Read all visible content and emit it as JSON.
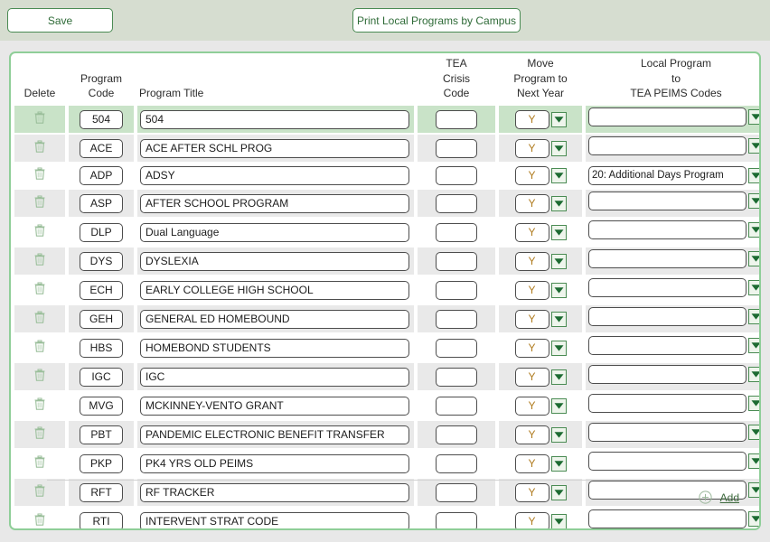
{
  "toolbar": {
    "save_label": "Save",
    "print_label": "Print Local Programs by Campus"
  },
  "table": {
    "headers": {
      "delete": "Delete",
      "program_code": "Program\nCode",
      "program_code_line1": "Program",
      "program_code_line2": "Code",
      "program_title": "Program Title",
      "tea_crisis_code_line1": "TEA",
      "tea_crisis_code_line2": "Crisis",
      "tea_crisis_code_line3": "Code",
      "move_program_line1": "Move",
      "move_program_line2": "Program to",
      "move_program_line3": "Next Year",
      "local_program_line1": "Local Program",
      "local_program_line2": "to",
      "local_program_line3": "TEA PEIMS Codes"
    },
    "rows": [
      {
        "code": "504",
        "title": "504",
        "crisis": "",
        "move": "Y",
        "peims": "",
        "selected": true
      },
      {
        "code": "ACE",
        "title": "ACE AFTER SCHL PROG",
        "crisis": "",
        "move": "Y",
        "peims": "",
        "selected": false
      },
      {
        "code": "ADP",
        "title": "ADSY",
        "crisis": "",
        "move": "Y",
        "peims": "20: Additional Days Program",
        "selected": false
      },
      {
        "code": "ASP",
        "title": "AFTER SCHOOL PROGRAM",
        "crisis": "",
        "move": "Y",
        "peims": "",
        "selected": false
      },
      {
        "code": "DLP",
        "title": "Dual Language",
        "crisis": "",
        "move": "Y",
        "peims": "",
        "selected": false
      },
      {
        "code": "DYS",
        "title": "DYSLEXIA",
        "crisis": "",
        "move": "Y",
        "peims": "",
        "selected": false
      },
      {
        "code": "ECH",
        "title": "EARLY COLLEGE HIGH SCHOOL",
        "crisis": "",
        "move": "Y",
        "peims": "",
        "selected": false
      },
      {
        "code": "GEH",
        "title": "GENERAL ED HOMEBOUND",
        "crisis": "",
        "move": "Y",
        "peims": "",
        "selected": false
      },
      {
        "code": "HBS",
        "title": "HOMEBOND STUDENTS",
        "crisis": "",
        "move": "Y",
        "peims": "",
        "selected": false
      },
      {
        "code": "IGC",
        "title": "IGC",
        "crisis": "",
        "move": "Y",
        "peims": "",
        "selected": false
      },
      {
        "code": "MVG",
        "title": "MCKINNEY-VENTO GRANT",
        "crisis": "",
        "move": "Y",
        "peims": "",
        "selected": false
      },
      {
        "code": "PBT",
        "title": "PANDEMIC ELECTRONIC BENEFIT TRANSFER",
        "crisis": "",
        "move": "Y",
        "peims": "",
        "selected": false
      },
      {
        "code": "PKP",
        "title": "PK4 YRS OLD PEIMS",
        "crisis": "",
        "move": "Y",
        "peims": "",
        "selected": false
      },
      {
        "code": "RFT",
        "title": "RF TRACKER",
        "crisis": "",
        "move": "Y",
        "peims": "",
        "selected": false
      },
      {
        "code": "RTI",
        "title": "INTERVENT STRAT CODE",
        "crisis": "",
        "move": "Y",
        "peims": "",
        "selected": false
      }
    ]
  },
  "footer": {
    "add_label": "Add",
    "add_icon": "plus-circle-icon"
  },
  "icons": {
    "delete_row": "trash-icon",
    "dropdown": "chevron-down-icon"
  },
  "colors": {
    "page_background": "#e8e8e8",
    "toolbar_background": "#d6ddd0",
    "panel_border": "#8fce98",
    "accent_green": "#4a8b53",
    "selected_row": "#c9e3c8",
    "stripe_row": "#e9e9e9"
  }
}
